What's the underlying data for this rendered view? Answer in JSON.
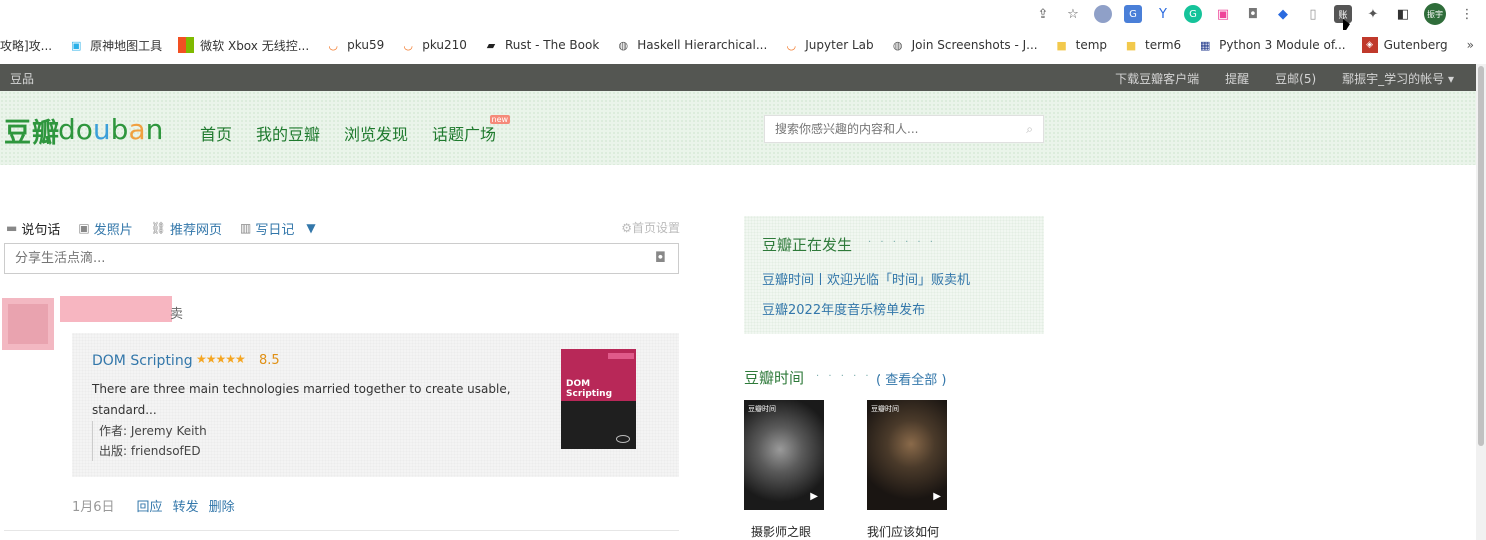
{
  "bookmarks": [
    {
      "label": "攻略]攻...",
      "icon": "doc-icon"
    },
    {
      "label": "原神地图工具",
      "icon": "bilibili-icon"
    },
    {
      "label": "微软 Xbox 无线控...",
      "icon": "microsoft-icon"
    },
    {
      "label": "pku59",
      "icon": "jupyter-icon"
    },
    {
      "label": "pku210",
      "icon": "jupyter-icon"
    },
    {
      "label": "Rust - The Book",
      "icon": "book-icon"
    },
    {
      "label": "Haskell Hierarchical...",
      "icon": "globe-icon"
    },
    {
      "label": "Jupyter Lab",
      "icon": "jupyter-icon"
    },
    {
      "label": "Join Screenshots - J...",
      "icon": "globe-icon"
    },
    {
      "label": "temp",
      "icon": "folder-icon"
    },
    {
      "label": "term6",
      "icon": "folder-icon"
    },
    {
      "label": "Python 3 Module of...",
      "icon": "grid-icon"
    },
    {
      "label": "Gutenberg",
      "icon": "gutenberg-icon"
    }
  ],
  "bookmarks_more": "»",
  "profile_chip": "振宇",
  "dark_nav": {
    "site": "豆品",
    "items": [
      "下载豆瓣客户端",
      "提醒",
      "豆邮(5)",
      "鄢振宇_学习的帐号 ▾"
    ]
  },
  "logo": {
    "cn": "豆瓣",
    "en": [
      "d",
      "o",
      "u",
      "b",
      "a",
      "n"
    ]
  },
  "main_nav": [
    "首页",
    "我的豆瓣",
    "浏览发现",
    "话题广场"
  ],
  "new_badge": "new",
  "search": {
    "placeholder": "搜索你感兴趣的内容和人..."
  },
  "composer": {
    "tabs": [
      "说句话",
      "发照片",
      "推荐网页",
      "写日记"
    ],
    "settings": "首页设置",
    "placeholder": "分享生活点滴..."
  },
  "feed": {
    "action": "卖",
    "book": {
      "title": "DOM Scripting",
      "stars": "★★★★★",
      "rating": "8.5",
      "desc_1": "There are three main technologies married together to create usable,",
      "desc_2": "standard...",
      "author": "作者: Jeremy Keith",
      "publisher": "出版: friendsofED",
      "cover_title": "DOM Scripting"
    },
    "date": "1月6日",
    "actions": [
      "回应",
      "转发",
      "删除"
    ]
  },
  "happening": {
    "title": "豆瓣正在发生",
    "dots": "· · · · · ·",
    "links": [
      "豆瓣时间丨欢迎光临「时间」贩卖机",
      "豆瓣2022年度音乐榜单发布"
    ]
  },
  "time": {
    "title": "豆瓣时间",
    "dots": "· · · · · ·",
    "all": "( 查看全部 )",
    "tag": "豆瓣时间",
    "cards": [
      "摄影师之眼",
      "我们应该如何"
    ]
  }
}
